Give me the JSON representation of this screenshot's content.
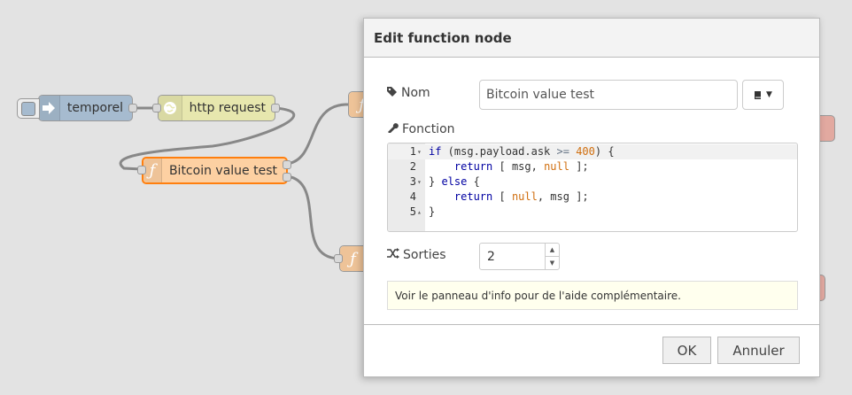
{
  "flow": {
    "nodes": {
      "inject": {
        "label": "temporel",
        "color": "#a6bbcf"
      },
      "http": {
        "label": "http request",
        "color": "#e7e7ae"
      },
      "function": {
        "label": "Bitcoin value test",
        "color": "#fdd0a2"
      },
      "function_out1": {
        "color": "#fdd0a2"
      },
      "function_out2": {
        "color": "#fdd0a2"
      }
    }
  },
  "dialog": {
    "title": "Edit function node",
    "name_label": "Nom",
    "name_value": "Bitcoin value test",
    "function_label": "Fonction",
    "outputs_label": "Sorties",
    "outputs_value": "2",
    "tip": "Voir le panneau d'info pour de l'aide complémentaire.",
    "ok_label": "OK",
    "cancel_label": "Annuler"
  },
  "editor": {
    "lines": [
      {
        "number": "1",
        "fold": "▾"
      },
      {
        "number": "2",
        "fold": ""
      },
      {
        "number": "3",
        "fold": "▾"
      },
      {
        "number": "4",
        "fold": ""
      },
      {
        "number": "5",
        "fold": "▴"
      }
    ],
    "code": "if (msg.payload.ask >= 400) {\n    return [ msg, null ];\n} else {\n    return [ null, msg ];\n}"
  },
  "icons": {
    "inject": "arrow-in-icon",
    "http": "globe-icon",
    "function": "function-icon",
    "name": "tag-icon",
    "fonction": "wrench-icon",
    "outputs": "shuffle-icon",
    "icon_picker": "book-icon"
  },
  "colors": {
    "accent": "#ff7f0e",
    "wire": "#888888",
    "tip_bg": "#ffffee"
  }
}
